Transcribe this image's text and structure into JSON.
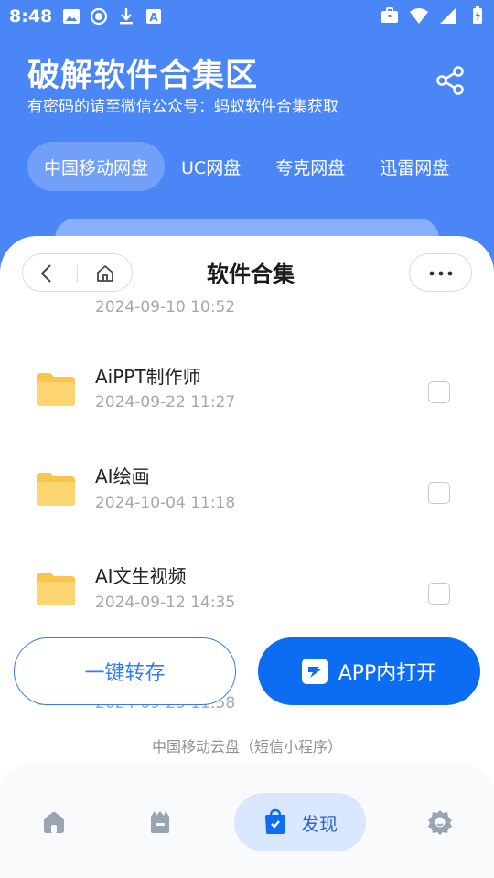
{
  "status": {
    "time": "8:48",
    "left_icons": [
      "image-icon",
      "record-icon",
      "download-icon",
      "font-icon"
    ],
    "right_icons": [
      "briefcase-icon",
      "wifi-icon",
      "signal-icon",
      "battery-icon"
    ]
  },
  "header": {
    "title": "破解软件合集区",
    "subtitle": "有密码的请至微信公众号：蚂蚁软件合集获取",
    "share_icon": "share-icon"
  },
  "tabs": [
    {
      "label": "中国移动网盘",
      "active": true
    },
    {
      "label": "UC网盘",
      "active": false
    },
    {
      "label": "夸克网盘",
      "active": false
    },
    {
      "label": "迅雷网盘",
      "active": false
    }
  ],
  "sheet": {
    "title": "软件合集",
    "back_icon": "back-icon",
    "home_icon": "home-icon",
    "more_icon": "more-icon"
  },
  "files": [
    {
      "name": "",
      "date": "2024-09-10 10:52",
      "icon": "folder-icon"
    },
    {
      "name": "AiPPT制作师",
      "date": "2024-09-22 11:27",
      "icon": "folder-icon"
    },
    {
      "name": "AI绘画",
      "date": "2024-10-04 11:18",
      "icon": "folder-icon"
    },
    {
      "name": "AI文生视频",
      "date": "2024-09-12 14:35",
      "icon": "folder-icon"
    },
    {
      "name": "",
      "date": "2024-09-23 11:58",
      "icon": "folder-icon"
    }
  ],
  "actions": {
    "save_label": "一键转存",
    "open_label": "APP内打开",
    "open_icon": "cloud-app-icon"
  },
  "footnote": "中国移动云盘（短信小程序）",
  "bottom_nav": {
    "items": [
      {
        "icon": "home-icon",
        "label": "",
        "active": false
      },
      {
        "icon": "briefcase-icon",
        "label": "",
        "active": false
      },
      {
        "icon": "shopping-bag-icon",
        "label": "发现",
        "active": true
      },
      {
        "icon": "settings-icon",
        "label": "",
        "active": false
      }
    ]
  },
  "colors": {
    "header_blue": "#4b86f7",
    "primary_blue": "#0d6df2",
    "folder_yellow": "#f9c64b",
    "nav_active_bg": "#d9e8ff"
  }
}
